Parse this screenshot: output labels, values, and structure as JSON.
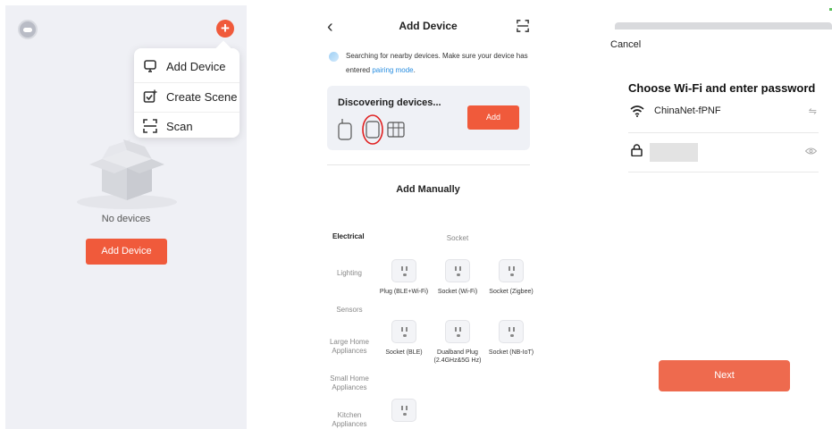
{
  "panel1": {
    "menu": [
      {
        "label": "Add Device",
        "icon": "add-device-icon"
      },
      {
        "label": "Create Scene",
        "icon": "create-scene-icon"
      },
      {
        "label": "Scan",
        "icon": "scan-icon"
      }
    ],
    "empty_text": "No devices",
    "add_button": "Add Device"
  },
  "panel2": {
    "title": "Add Device",
    "hint_text": "Searching for nearby devices. Make sure your device has entered ",
    "hint_link": "pairing mode",
    "hint_end": ".",
    "discovering": "Discovering devices...",
    "add_button": "Add",
    "manual_title": "Add Manually",
    "categories": [
      "Electrical",
      "Lighting",
      "Sensors",
      "Large Home Appliances",
      "Small Home Appliances",
      "Kitchen Appliances"
    ],
    "section_header": "Socket",
    "devices": [
      {
        "label": "Plug (BLE+Wi-Fi)"
      },
      {
        "label": "Socket (Wi-Fi)"
      },
      {
        "label": "Socket (Zigbee)"
      },
      {
        "label": "Socket (BLE)"
      },
      {
        "label": "Dualband Plug (2.4GHz&5G Hz)"
      },
      {
        "label": "Socket (NB-IoT)"
      },
      {
        "label": ""
      }
    ]
  },
  "panel3": {
    "cancel": "Cancel",
    "title": "Choose Wi-Fi and enter password",
    "ssid": "ChinaNet-fPNF",
    "next_button": "Next"
  },
  "colors": {
    "accent": "#f05a3b",
    "link": "#2a8ee0"
  }
}
